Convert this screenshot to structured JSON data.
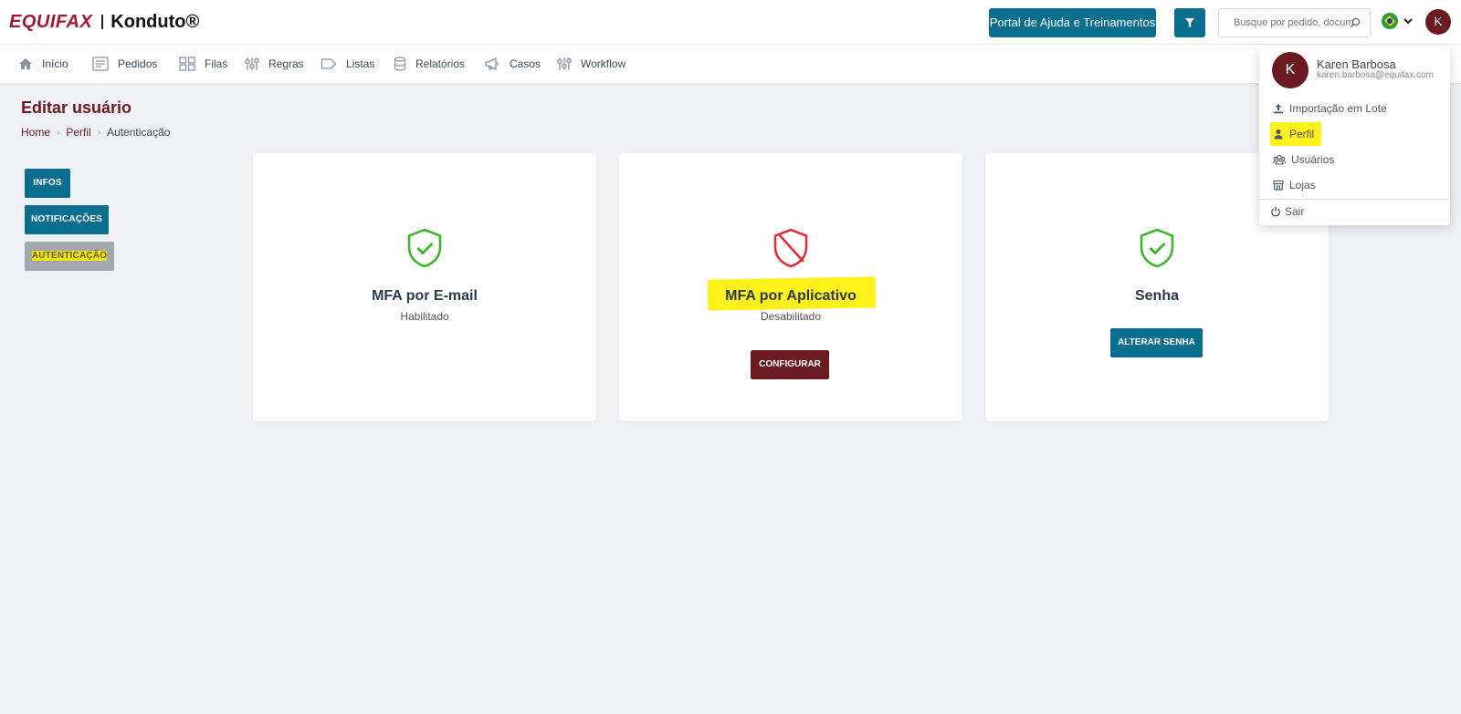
{
  "header": {
    "brand_primary": "EQUIFAX",
    "brand_secondary": "Konduto®",
    "help_button": "Portal de Ajuda e Treinamentos",
    "search_placeholder": "Busque por pedido, documento",
    "avatar_initial": "K"
  },
  "nav": {
    "items": [
      {
        "label": "Início",
        "icon": "home-icon"
      },
      {
        "label": "Pedidos",
        "icon": "orders-icon"
      },
      {
        "label": "Filas",
        "icon": "grid-icon"
      },
      {
        "label": "Regras",
        "icon": "sliders-icon"
      },
      {
        "label": "Listas",
        "icon": "tag-icon"
      },
      {
        "label": "Relatórios",
        "icon": "database-icon"
      },
      {
        "label": "Casos",
        "icon": "megaphone-icon"
      },
      {
        "label": "Workflow",
        "icon": "sliders-icon"
      }
    ]
  },
  "page": {
    "title": "Editar usuário",
    "breadcrumb": [
      "Home",
      "Perfil",
      "Autenticação"
    ]
  },
  "side_tabs": [
    "INFOS",
    "NOTIFICAÇÕES",
    "AUTENTICAÇÃO"
  ],
  "cards": [
    {
      "title": "MFA por E-mail",
      "status": "Habilitado",
      "icon": "shield-check-icon"
    },
    {
      "title": "MFA por Aplicativo",
      "status": "Desabilitado",
      "icon": "shield-off-icon",
      "button": "CONFIGURAR"
    },
    {
      "title": "Senha",
      "icon": "shield-check-icon",
      "button": "ALTERAR SENHA"
    }
  ],
  "user_menu": {
    "initial": "K",
    "name": "Karen Barbosa",
    "email": "karen.barbosa@equifax.com",
    "items": [
      "Importação em Lote",
      "Perfil",
      "Usuários",
      "Lojas"
    ],
    "logout": "Sair"
  },
  "colors": {
    "brand_wine": "#6b1a22",
    "brand_teal": "#0a6e8e",
    "success_green": "#3cb62a",
    "danger_red": "#e0303c",
    "highlight_yellow": "#fff000"
  }
}
